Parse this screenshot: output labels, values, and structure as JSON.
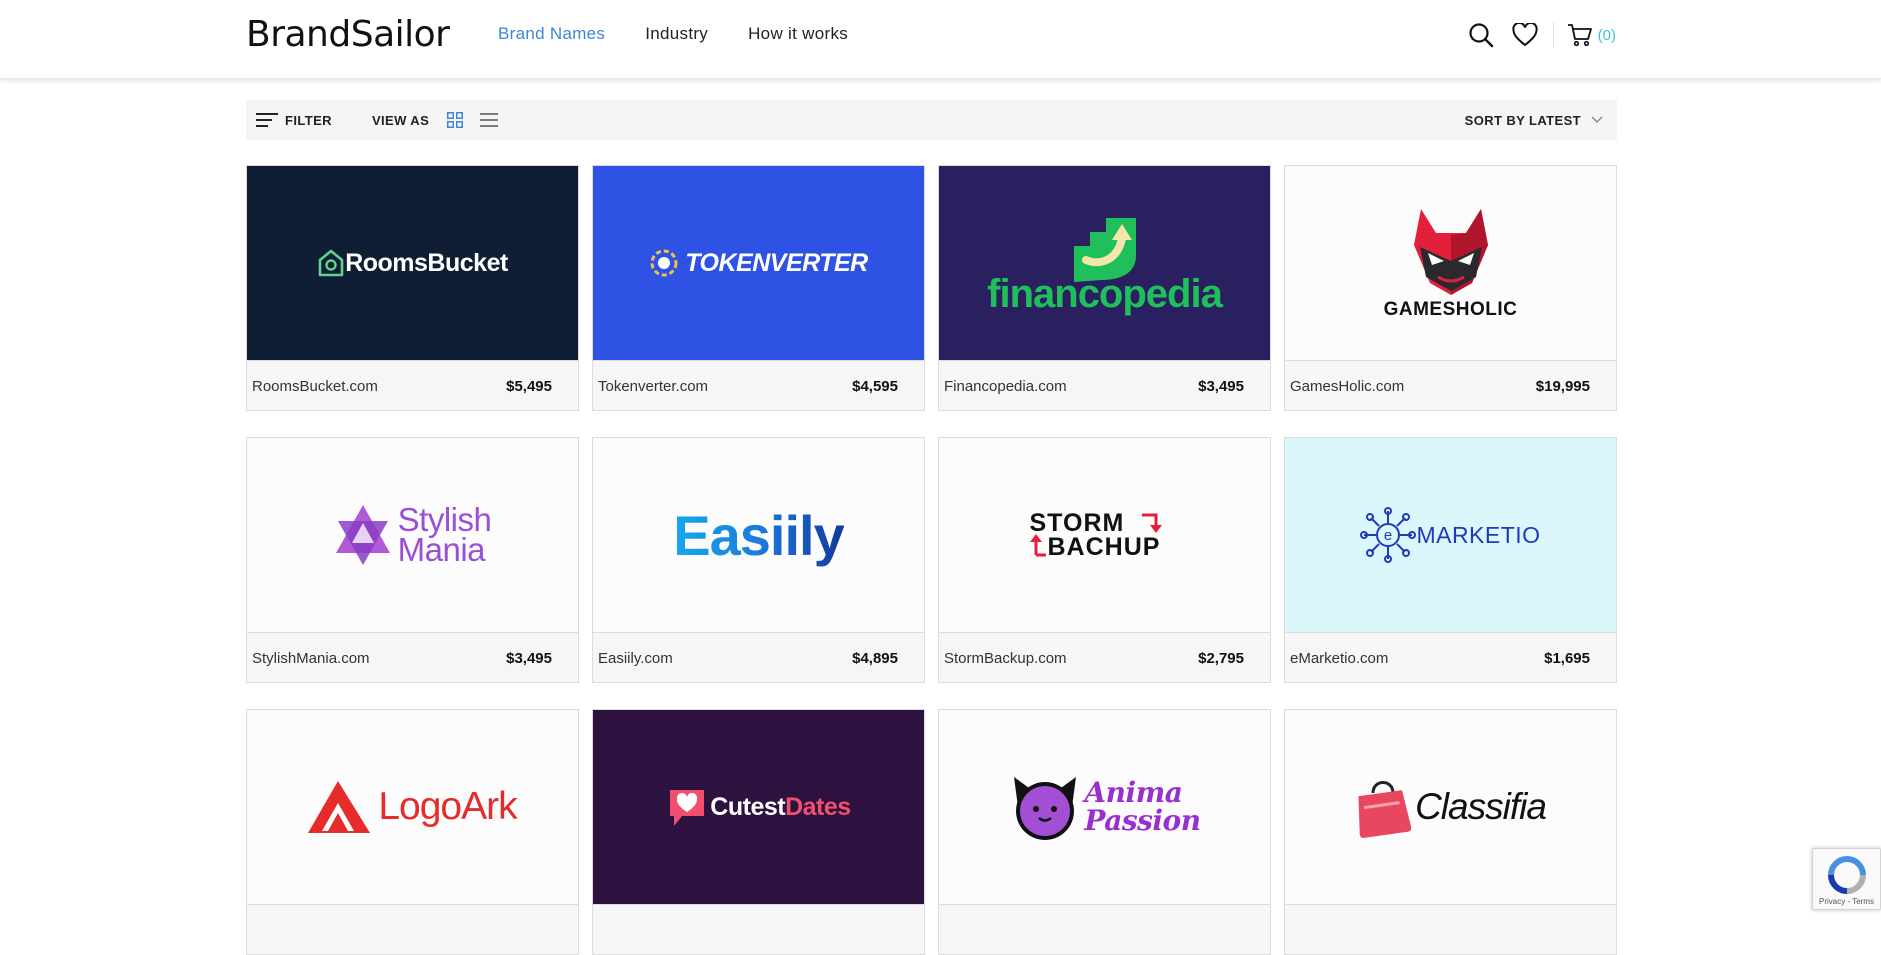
{
  "header": {
    "logo": "BrandSailor",
    "nav": [
      "Brand Names",
      "Industry",
      "How it works"
    ],
    "cart_count": "(0)",
    "icons": [
      "search-icon",
      "heart-icon",
      "cart-icon"
    ]
  },
  "toolbar": {
    "filter_label": "FILTER",
    "view_as_label": "VIEW AS",
    "sort_label": "SORT BY LATEST"
  },
  "colors": {
    "accent": "#3d86d4",
    "cart": "#3fc3d8"
  },
  "listings": [
    {
      "name": "RoomsBucket.com",
      "price": "$5,495",
      "logo_text": "RoomsBucket",
      "bg": "#0f1e35"
    },
    {
      "name": "Tokenverter.com",
      "price": "$4,595",
      "logo_text": "TOKENVERTER",
      "bg": "#2e52e3"
    },
    {
      "name": "Financopedia.com",
      "price": "$3,495",
      "logo_text": "financopedia",
      "bg": "#2a1f5f"
    },
    {
      "name": "GamesHolic.com",
      "price": "$19,995",
      "logo_text": "GAMESHOLIC",
      "bg": "#fcfcfc"
    },
    {
      "name": "StylishMania.com",
      "price": "$3,495",
      "logo_text_1": "Stylish",
      "logo_text_2": "Mania",
      "bg": "#fcfcfc"
    },
    {
      "name": "Easiily.com",
      "price": "$4,895",
      "logo_text": "Easiily",
      "bg": "#fcfcfc"
    },
    {
      "name": "StormBackup.com",
      "price": "$2,795",
      "logo_text_1": "STORM",
      "logo_text_2": "BACHUP",
      "bg": "#fcfcfc"
    },
    {
      "name": "eMarketio.com",
      "price": "$1,695",
      "logo_text": "MARKETIO",
      "bg": "#dbf7fb"
    },
    {
      "name": "",
      "price": "",
      "logo_text": "LogoArk",
      "bg": "#fcfcfc"
    },
    {
      "name": "",
      "price": "",
      "logo_text": "CutestDates",
      "bg": "#2d1240"
    },
    {
      "name": "",
      "price": "",
      "logo_text_1": "Anima",
      "logo_text_2": "Passion",
      "bg": "#fcfcfc"
    },
    {
      "name": "",
      "price": "",
      "logo_text": "Classifia",
      "bg": "#fcfcfc"
    }
  ],
  "recaptcha": {
    "text": "Privacy - Terms"
  }
}
